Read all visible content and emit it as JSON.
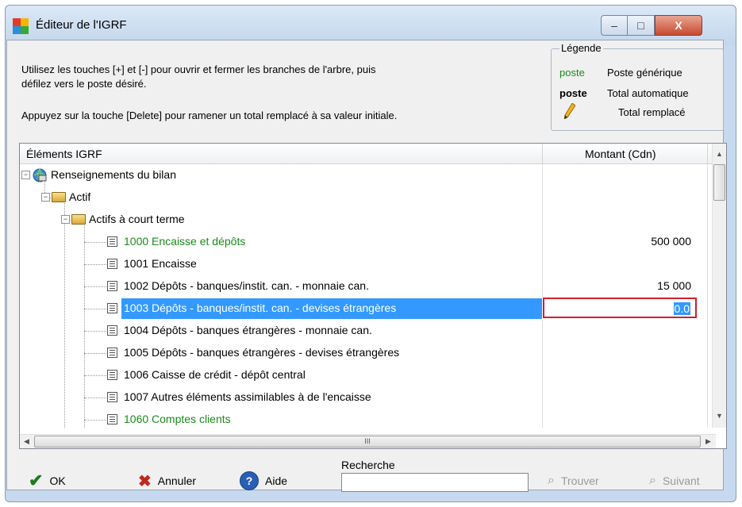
{
  "window": {
    "title": "Éditeur de l'IGRF",
    "controls": {
      "minimize": "–",
      "maximize": "□",
      "close": "X"
    }
  },
  "instructions": {
    "line1": "Utilisez les touches [+] et [-] pour ouvrir et fermer les branches de l'arbre, puis",
    "line2": "défilez vers le poste désiré.",
    "line3": "Appuyez sur la touche [Delete] pour ramener un total remplacé à sa valeur initiale."
  },
  "legend": {
    "title": "Légende",
    "items": [
      {
        "sample": "poste",
        "text": "Poste générique"
      },
      {
        "sample": "poste",
        "text": "Total automatique"
      },
      {
        "sample": "pencil-icon",
        "text": "Total remplacé"
      }
    ]
  },
  "tree": {
    "columns": {
      "item": "Éléments IGRF",
      "amount": "Montant (Cdn)"
    },
    "rows": [
      {
        "label": "Renseignements du bilan",
        "amount": "",
        "level": 0
      },
      {
        "label": "Actif",
        "amount": "",
        "level": 1
      },
      {
        "label": "Actifs à court terme",
        "amount": "",
        "level": 2
      },
      {
        "label": "1000  Encaisse et dépôts",
        "amount": "500 000",
        "level": 3,
        "style": "green"
      },
      {
        "label": "1001  Encaisse",
        "amount": "",
        "level": 3
      },
      {
        "label": "1002  Dépôts - banques/instit. can. - monnaie can.",
        "amount": "15 000",
        "level": 3
      },
      {
        "label": "1003  Dépôts - banques/instit. can. - devises étrangères",
        "amount": "",
        "level": 3,
        "selected": true,
        "edit_value": "0.0"
      },
      {
        "label": "1004  Dépôts - banques étrangères - monnaie can.",
        "amount": "",
        "level": 3
      },
      {
        "label": "1005  Dépôts - banques étrangères - devises étrangères",
        "amount": "",
        "level": 3
      },
      {
        "label": "1006  Caisse de crédit - dépôt central",
        "amount": "",
        "level": 3
      },
      {
        "label": "1007  Autres éléments assimilables à de l'encaisse",
        "amount": "",
        "level": 3
      },
      {
        "label": "1060  Comptes clients",
        "amount": "",
        "level": 3,
        "style": "green"
      }
    ],
    "scroll_marker": "III"
  },
  "footer": {
    "ok": "OK",
    "cancel": "Annuler",
    "help": "Aide",
    "search_label": "Recherche",
    "search_value": "",
    "find": "Trouver",
    "next": "Suivant"
  },
  "colors": {
    "selection": "#3399ff",
    "generic": "#1a8a1a",
    "edit_border": "#d11f2b"
  }
}
